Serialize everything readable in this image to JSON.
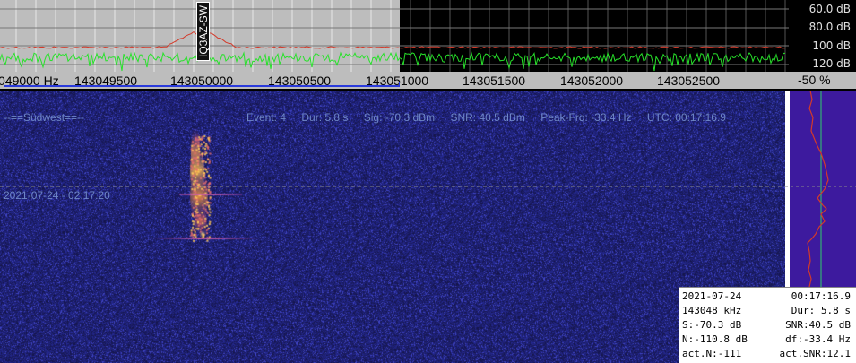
{
  "spectrum": {
    "db_scale": [
      "60.0 dB",
      "80.0 dB",
      "100 dB",
      "120 dB"
    ],
    "callsign_marker": "IQ3AZ-SW",
    "colors": {
      "max_trace": "#d33a2a",
      "live_trace": "#27e22a",
      "grid": "#ffffff",
      "passband_bg": "#bdbdbd"
    }
  },
  "frequency_axis": {
    "unit": "Hz",
    "labels": [
      "049000 Hz",
      "143049500",
      "143050000",
      "143050500",
      "143051000",
      "143051500",
      "143052000",
      "143052500"
    ],
    "passband_color": "#2a3adb"
  },
  "level": {
    "value": "-50 %"
  },
  "waterfall": {
    "location": "--==Südwest==--",
    "timestamp": "2021-07-24 - 02:17:20",
    "event": {
      "event": "Event: 4",
      "duration": "Dur: 5.8 s",
      "signal": "Sig: -70.3 dBm",
      "snr": "SNR: 40.5 dBm",
      "peak_freq": "Peak-Frq: -33.4 Hz",
      "utc": "UTC: 00:17:16.9"
    }
  },
  "info_panel": {
    "rows": [
      {
        "left": "2021-07-24",
        "right": "00:17:16.9"
      },
      {
        "left": "143048 kHz",
        "right": "Dur: 5.8 s"
      },
      {
        "left": "S:-70.3 dB",
        "right": "SNR:40.5 dB"
      },
      {
        "left": "N:-110.8 dB",
        "right": "df:-33.4 Hz"
      },
      {
        "left": "act.N:-111",
        "right": "act.SNR:12.1"
      }
    ]
  }
}
